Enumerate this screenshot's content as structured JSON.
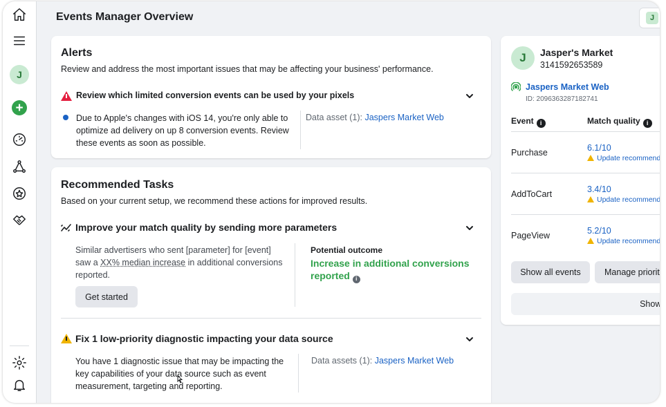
{
  "header": {
    "title": "Events Manager Overview",
    "account_initial": "J"
  },
  "nav": {
    "avatar_initial": "J"
  },
  "alerts": {
    "title": "Alerts",
    "subtitle": "Review and address the most important issues that may be affecting your business' performance.",
    "item": {
      "title": "Review which limited conversion events can be used by your pixels",
      "body_lines": [
        "Due to Apple's changes with iOS 14, you're only able to",
        "optimize ad delivery on up 8 conversion events. Review",
        "these events as soon as possible."
      ],
      "asset_label": "Data asset (1):",
      "asset_link": "Jaspers Market Web"
    }
  },
  "tasks": {
    "title": "Recommended Tasks",
    "subtitle": "Based on your current setup, we recommend these actions for improved results.",
    "task1": {
      "title": "Improve your match quality by sending more parameters",
      "line1": "Similar advertisers who sent [parameter] for [event]",
      "line2_pre": "saw a ",
      "line2_underline": "XX% median increase",
      "line2_post": " in additional conversions",
      "line3": "reported.",
      "button": "Get started",
      "outcome_label": "Potential outcome",
      "outcome_line1": "Increase in additional conversions",
      "outcome_line2": "reported"
    },
    "task2": {
      "title": "Fix 1 low-priority diagnostic impacting your data source",
      "body_lines": [
        "You have 1 diagnostic issue that may be impacting the",
        "key capabilities of your data source such as event",
        "measurement, targeting and reporting."
      ],
      "asset_label": "Data assets (1):",
      "asset_link": "Jaspers Market Web"
    }
  },
  "business": {
    "initial": "J",
    "name": "Jasper's Market",
    "id": "3141592653589",
    "dataset_name": "Jaspers Market Web",
    "dataset_id": "ID: 2096363287182741",
    "col_event": "Event",
    "col_quality": "Match quality",
    "events": [
      {
        "name": "Purchase",
        "score": "6.1/10",
        "note": "Update recommend"
      },
      {
        "name": "AddToCart",
        "score": "3.4/10",
        "note": "Update recommend"
      },
      {
        "name": "PageView",
        "score": "5.2/10",
        "note": "Update recommend"
      }
    ],
    "btn_show_all": "Show all events",
    "btn_manage": "Manage priorit",
    "btn_show_more": "Show r"
  }
}
